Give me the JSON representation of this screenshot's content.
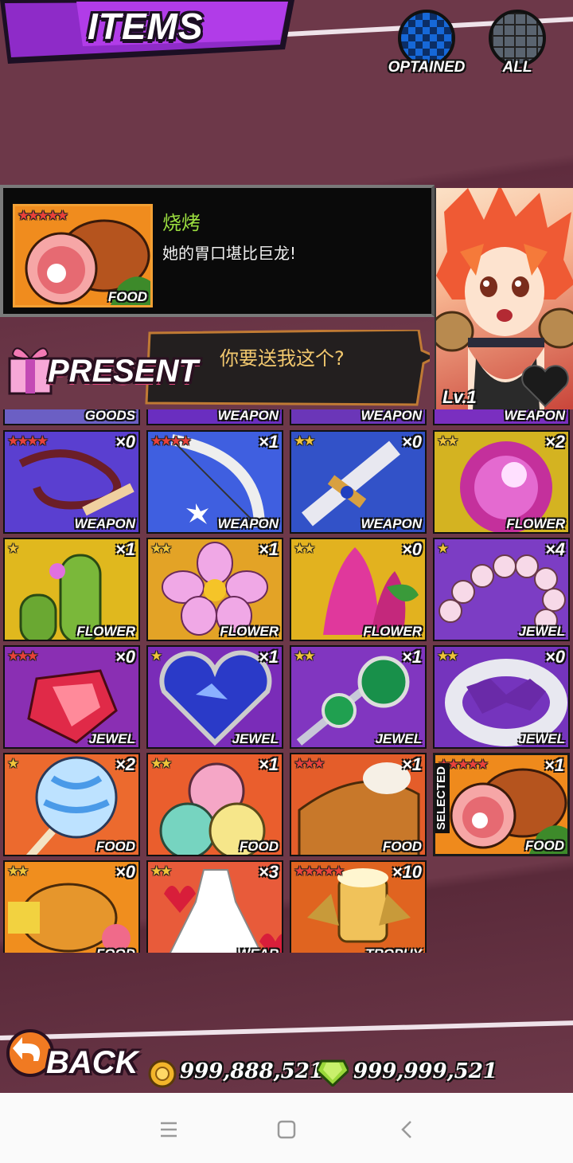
{
  "header": {
    "title": "ITEMS",
    "filters": [
      {
        "label": "OPTAINED",
        "icon": "checker-icon",
        "color": "#1668d8"
      },
      {
        "label": "ALL",
        "icon": "grid-icon",
        "color": "#5a6470"
      }
    ]
  },
  "selected_item": {
    "rarity": "★★★★★",
    "category": "FOOD",
    "name": "烧烤",
    "description": "她的胃口堪比巨龙!"
  },
  "character": {
    "level": "Lv.1",
    "speech": "你要送我这个?",
    "present_label": "PRESENT"
  },
  "partial_row": [
    {
      "category": "GOODS"
    },
    {
      "category": "WEAPON"
    },
    {
      "category": "WEAPON"
    },
    {
      "category": "WEAPON"
    }
  ],
  "items": [
    {
      "rarity": "★★★★",
      "count": "×0",
      "category": "WEAPON",
      "bg": "#5a3fd0",
      "art": "whip"
    },
    {
      "rarity": "★★★★",
      "count": "×1",
      "category": "WEAPON",
      "bg": "#3f5fe0",
      "art": "bow"
    },
    {
      "rarity": "★★",
      "count": "×0",
      "category": "WEAPON",
      "bg": "#3252c8",
      "art": "sword"
    },
    {
      "rarity": "★★",
      "count": "×2",
      "category": "FLOWER",
      "bg": "#d4b321",
      "art": "morning-glory"
    },
    {
      "rarity": "★",
      "count": "×1",
      "category": "FLOWER",
      "bg": "#e0b81e",
      "art": "cactus"
    },
    {
      "rarity": "★★",
      "count": "×1",
      "category": "FLOWER",
      "bg": "#e3a326",
      "art": "cosmos"
    },
    {
      "rarity": "★★",
      "count": "×0",
      "category": "FLOWER",
      "bg": "#e2b21f",
      "art": "celosia"
    },
    {
      "rarity": "★",
      "count": "×4",
      "category": "JEWEL",
      "bg": "#7c3dc4",
      "art": "pearls"
    },
    {
      "rarity": "★★★",
      "count": "×0",
      "category": "JEWEL",
      "bg": "#8a2fb3",
      "art": "ruby"
    },
    {
      "rarity": "★",
      "count": "×1",
      "category": "JEWEL",
      "bg": "#7a2cb8",
      "art": "sapphire"
    },
    {
      "rarity": "★★",
      "count": "×1",
      "category": "JEWEL",
      "bg": "#8136c0",
      "art": "emerald"
    },
    {
      "rarity": "★★",
      "count": "×0",
      "category": "JEWEL",
      "bg": "#7534bd",
      "art": "ring"
    },
    {
      "rarity": "★",
      "count": "×2",
      "category": "FOOD",
      "bg": "#ec6a2e",
      "art": "lollipop"
    },
    {
      "rarity": "★★",
      "count": "×1",
      "category": "FOOD",
      "bg": "#ea5e2d",
      "art": "ice-cream"
    },
    {
      "rarity": "★★★",
      "count": "×1",
      "category": "FOOD",
      "bg": "#e45d2a",
      "art": "pie"
    },
    {
      "rarity": "★★★★★",
      "count": "×1",
      "category": "FOOD",
      "bg": "#ef8a1c",
      "art": "meat",
      "selected": true
    },
    {
      "rarity": "★★",
      "count": "×0",
      "category": "FOOD",
      "bg": "#f08e1e",
      "art": "chicken"
    },
    {
      "rarity": "★★",
      "count": "×3",
      "category": "WEAR",
      "bg": "#e85b3a",
      "art": "dress"
    },
    {
      "rarity": "★★★★★",
      "count": "×10",
      "category": "TROPHY",
      "bg": "#e06420",
      "art": "trophy"
    }
  ],
  "selected_label": "SELECTED",
  "footer": {
    "back_label": "BACK",
    "coins": "999,888,521",
    "gems": "999,999,521"
  }
}
